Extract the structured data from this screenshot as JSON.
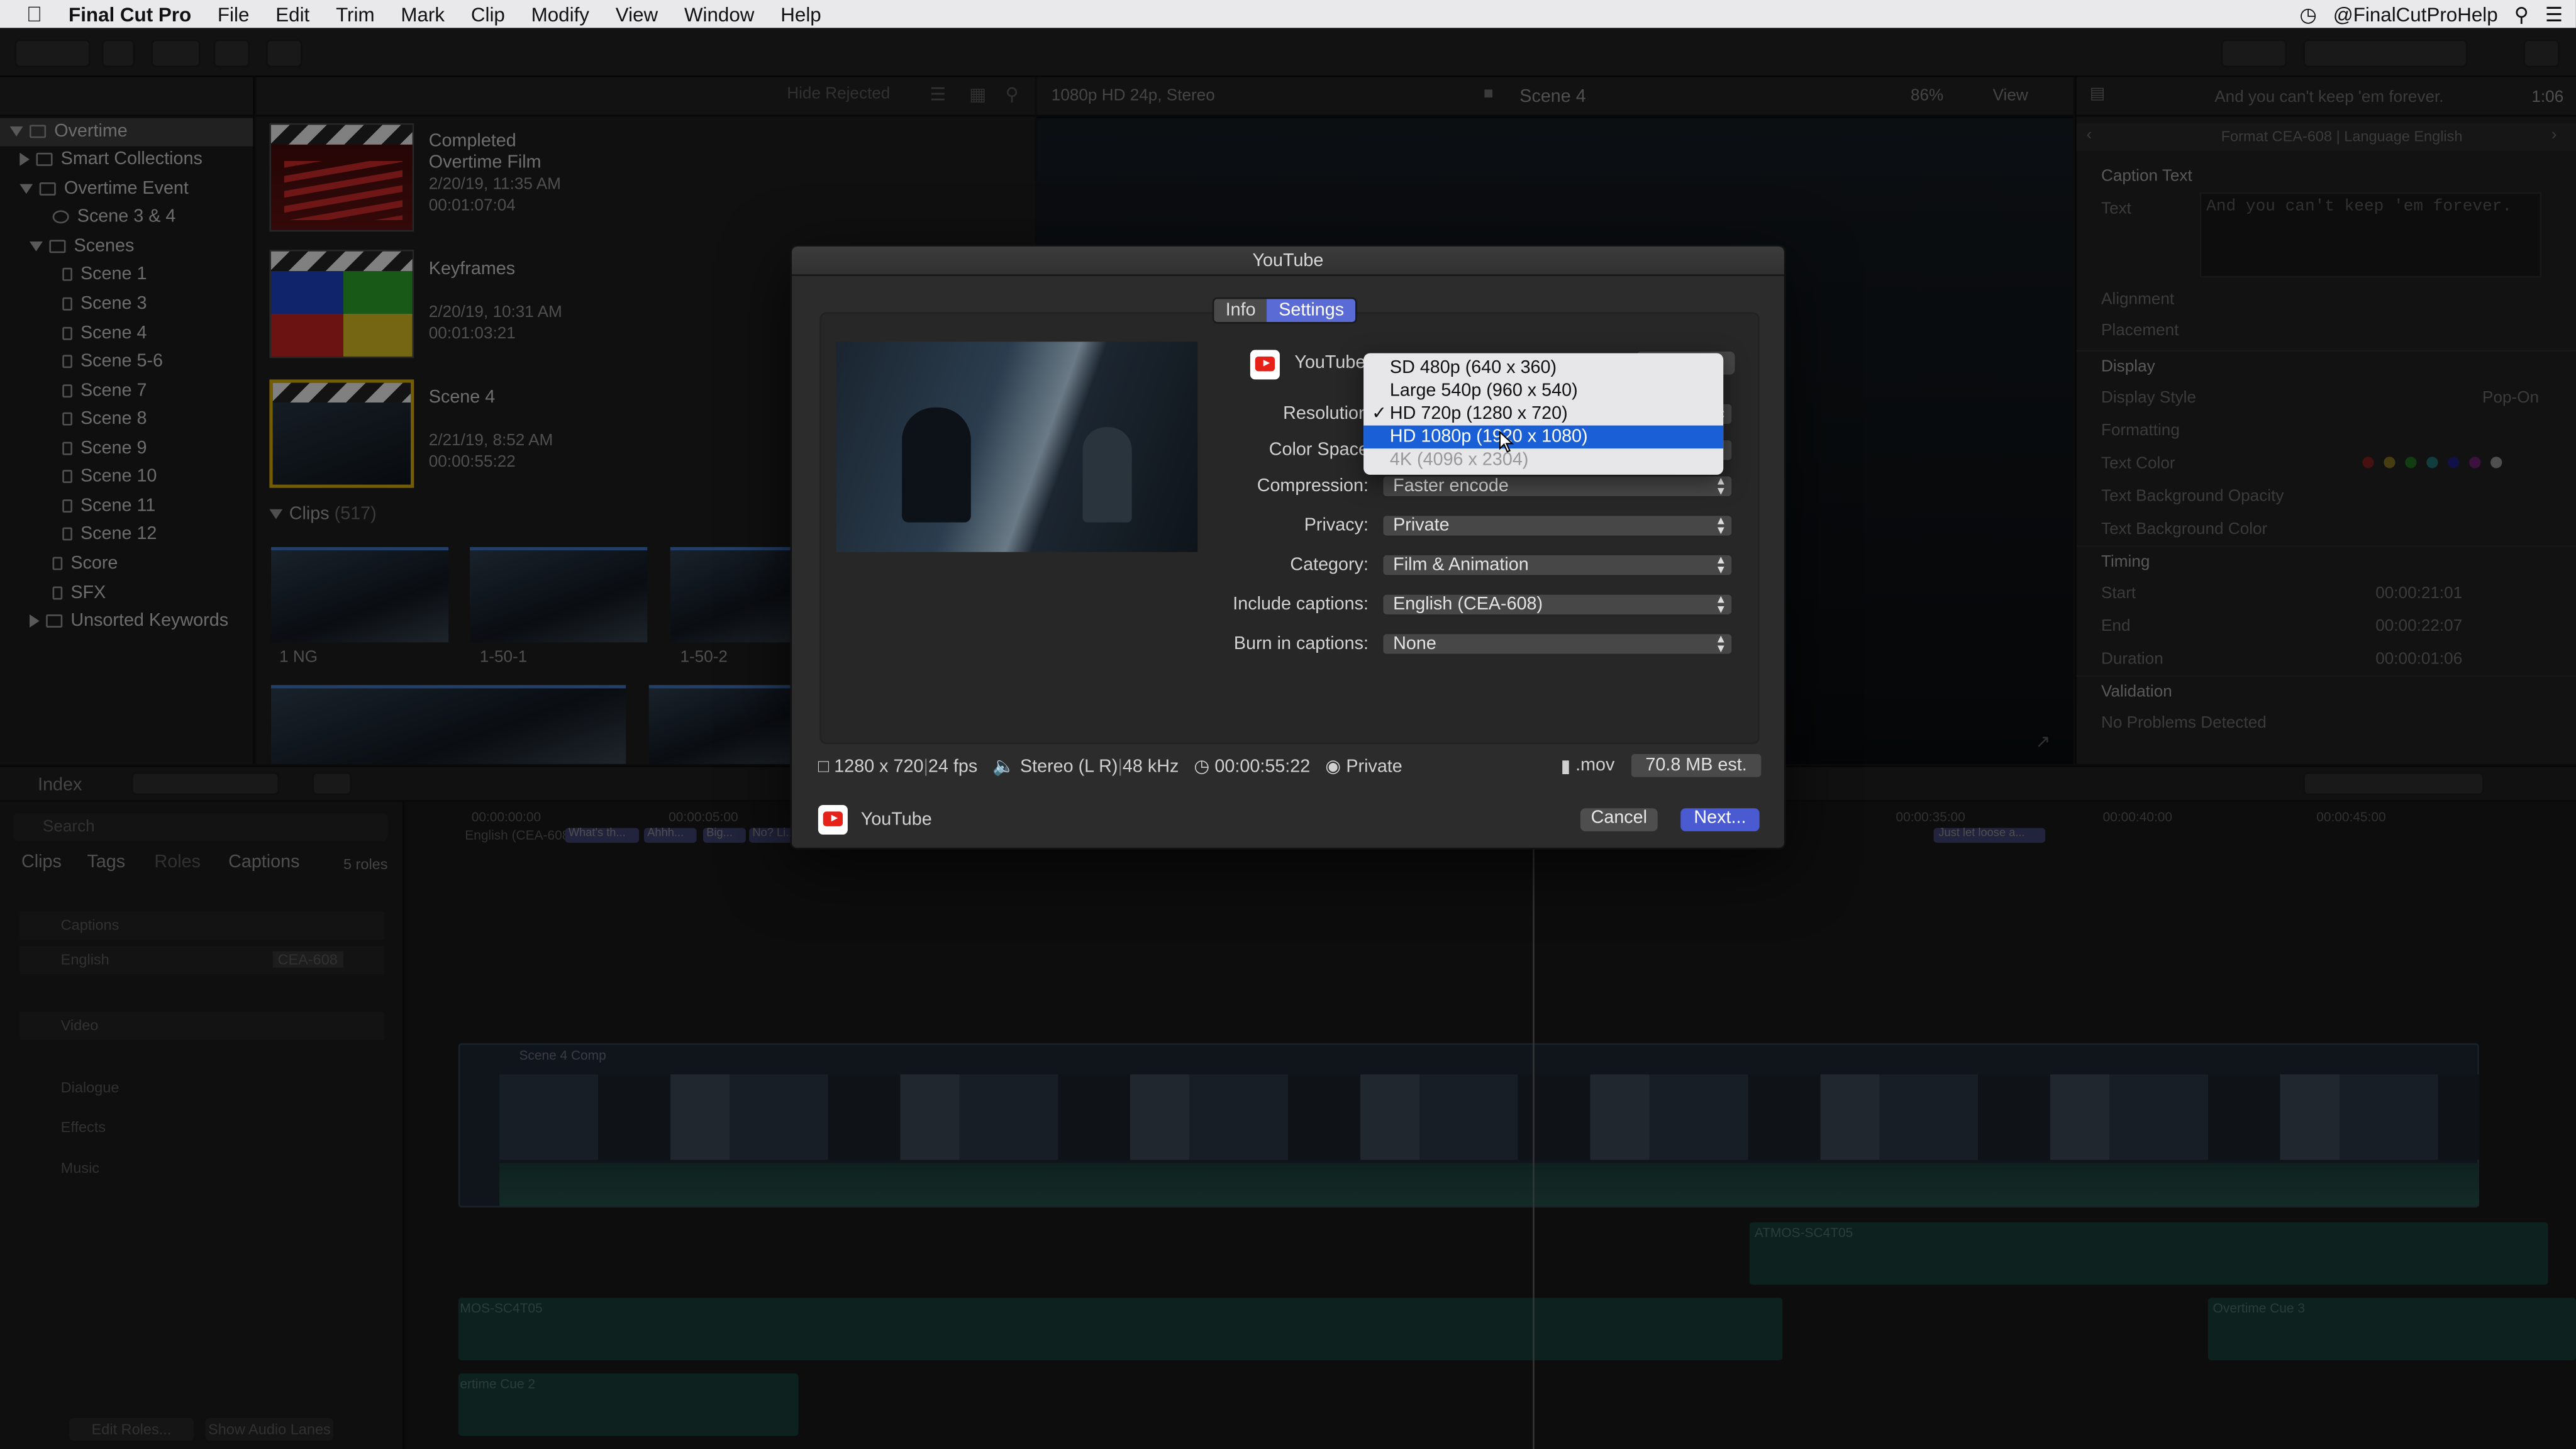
{
  "menubar": {
    "app": "Final Cut Pro",
    "menus": [
      "File",
      "Edit",
      "Trim",
      "Mark",
      "Clip",
      "Modify",
      "View",
      "Window",
      "Help"
    ],
    "right_user": "@FinalCutProHelp"
  },
  "library": {
    "items": [
      {
        "label": "Overtime",
        "indent": 0
      },
      {
        "label": "Smart Collections",
        "indent": 1
      },
      {
        "label": "Overtime Event",
        "indent": 1
      },
      {
        "label": "Scene 3 & 4",
        "indent": 2
      },
      {
        "label": "Scenes",
        "indent": 1
      },
      {
        "label": "Scene 1",
        "indent": 3
      },
      {
        "label": "Scene 3",
        "indent": 3
      },
      {
        "label": "Scene 4",
        "indent": 3
      },
      {
        "label": "Scene 5-6",
        "indent": 3
      },
      {
        "label": "Scene 7",
        "indent": 3
      },
      {
        "label": "Scene 8",
        "indent": 3
      },
      {
        "label": "Scene 9",
        "indent": 3
      },
      {
        "label": "Scene 10",
        "indent": 3
      },
      {
        "label": "Scene 11",
        "indent": 3
      },
      {
        "label": "Scene 12",
        "indent": 3
      },
      {
        "label": "Score",
        "indent": 2
      },
      {
        "label": "SFX",
        "indent": 2
      },
      {
        "label": "Unsorted Keywords",
        "indent": 1
      }
    ]
  },
  "browser": {
    "filter": "Hide Rejected",
    "projects": [
      {
        "title": "Completed Overtime Film",
        "date": "2/20/19, 11:35 AM",
        "duration": "00:01:07:04"
      },
      {
        "title": "Keyframes",
        "date": "2/20/19, 10:31 AM",
        "duration": "00:01:03:21"
      },
      {
        "title": "Scene 4",
        "date": "2/21/19, 8:52 AM",
        "duration": "00:00:55:22"
      }
    ],
    "clips_header": "Clips",
    "clips_count": "(517)",
    "clips": [
      "1 NG",
      "1-50-1",
      "1-50-2"
    ]
  },
  "viewer": {
    "format": "1080p HD 24p, Stereo",
    "title": "Scene 4",
    "zoom": "86%",
    "view": "View"
  },
  "inspector": {
    "caption_preview": "And you can't keep 'em forever.",
    "timecode": "1:06",
    "format": "Format CEA-608 | Language English",
    "section_caption": "Caption Text",
    "text_label": "Text",
    "text_value": "And you can't keep 'em forever.",
    "rows": [
      "Alignment",
      "Placement",
      "Display",
      "Display Style",
      "Formatting",
      "Text Color",
      "Text Background Opacity",
      "Text Background Color",
      "Timing",
      "Start",
      "End",
      "Duration",
      "Validation",
      "No Problems Detected"
    ],
    "display_style_value": "Pop-On",
    "start": "00:00:21:01",
    "end": "00:00:22:07",
    "duration": "00:00:01:06"
  },
  "timeline_bar": {
    "index": "Index"
  },
  "index": {
    "search_placeholder": "Search",
    "tabs": [
      "Clips",
      "Tags",
      "Roles",
      "Captions"
    ],
    "roles_count": "5 roles",
    "roles": [
      "Captions",
      "English",
      "Video",
      "Dialogue",
      "Effects",
      "Music"
    ],
    "english_badge": "CEA-608",
    "edit_roles": "Edit Roles...",
    "show_audio_lanes": "Show Audio Lanes"
  },
  "timeline": {
    "ruler": [
      "00:00:00:00",
      "00:00:05:00",
      "00:00:35:00",
      "00:00:40:00",
      "00:00:45:00"
    ],
    "caption_lane": "English (CEA-608)",
    "captions": [
      "What's th...",
      "Ahhh...",
      "Big...",
      "No? Li...",
      "Just let loose a..."
    ],
    "primary": "Scene 4 Comp",
    "audio": [
      "ATMOS-SC4T05",
      "MOS-SC4T05",
      "Overtime Cue 3",
      "ertime Cue 2"
    ]
  },
  "dialog": {
    "title": "YouTube",
    "tabs": {
      "info": "Info",
      "settings": "Settings"
    },
    "destination": "YouTube",
    "labels": {
      "resolution": "Resolution",
      "color_space": "Color Space",
      "compression": "Compression:",
      "privacy": "Privacy:",
      "category": "Category:",
      "include_captions": "Include captions:",
      "burn_in": "Burn in captions:"
    },
    "values": {
      "compression": "Faster encode",
      "privacy": "Private",
      "category": "Film & Animation",
      "include_captions": "English (CEA-608)",
      "burn_in": "None"
    },
    "resolution_menu": [
      {
        "label": "SD 480p (640 x 360)",
        "state": "normal"
      },
      {
        "label": "Large 540p (960 x 540)",
        "state": "normal"
      },
      {
        "label": "HD 720p (1280 x 720)",
        "state": "checked"
      },
      {
        "label": "HD 1080p (1920 x 1080)",
        "state": "highlighted"
      },
      {
        "label": "4K (4096 x 2304)",
        "state": "disabled"
      }
    ],
    "summary": {
      "size": "1280 x 720",
      "fps": "24 fps",
      "audio": "Stereo (L R)",
      "rate": "48 kHz",
      "duration": "00:00:55:22",
      "privacy": "Private",
      "ext": ".mov",
      "estimate": "70.8 MB est."
    },
    "footer_service": "YouTube",
    "cancel": "Cancel",
    "next": "Next..."
  },
  "colors": {
    "accent": "#5a6bd6",
    "highlight": "#1a5fd6",
    "youtube": "#e62117",
    "audio_green": "#2f6b5a",
    "caption_purple": "#5a5fa8"
  }
}
